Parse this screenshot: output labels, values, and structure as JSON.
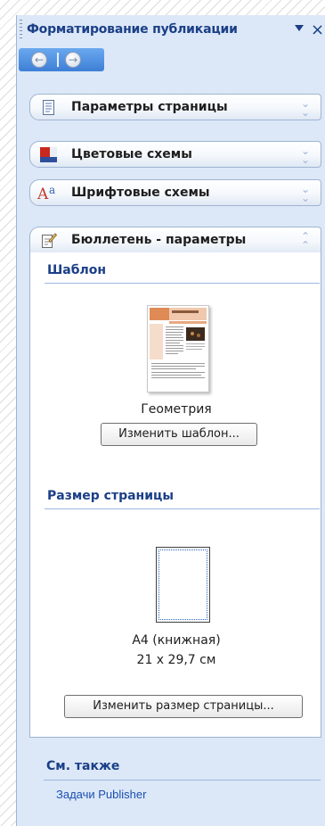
{
  "pane": {
    "title": "Форматирование публикации",
    "close_label": "×",
    "nav": {
      "back_icon": "back-arrow-icon",
      "forward_icon": "forward-arrow-icon"
    }
  },
  "sections": {
    "page_options": {
      "label": "Параметры страницы",
      "icon": "page-icon"
    },
    "color_schemes": {
      "label": "Цветовые схемы",
      "icon": "color-scheme-icon"
    },
    "font_schemes": {
      "label": "Шрифтовые схемы",
      "icon": "font-scheme-icon",
      "icon_text": "Aa"
    },
    "newsletter_options": {
      "label": "Бюллетень - параметры",
      "icon": "newsletter-icon",
      "template": {
        "heading": "Шаблон",
        "name": "Геометрия",
        "change_button": "Изменить шаблон..."
      },
      "page_size": {
        "heading": "Размер страницы",
        "format": "A4 (книжная)",
        "dimensions": "21 x 29,7 см",
        "change_button": "Изменить размер страницы..."
      }
    }
  },
  "see_also": {
    "heading": "См. также",
    "link": "Задачи Publisher"
  },
  "colors": {
    "pane_bg": "#dce8f7",
    "title_color": "#1b3f87",
    "link_color": "#1b4fb3",
    "nav_bar": "#4a8ae0"
  }
}
